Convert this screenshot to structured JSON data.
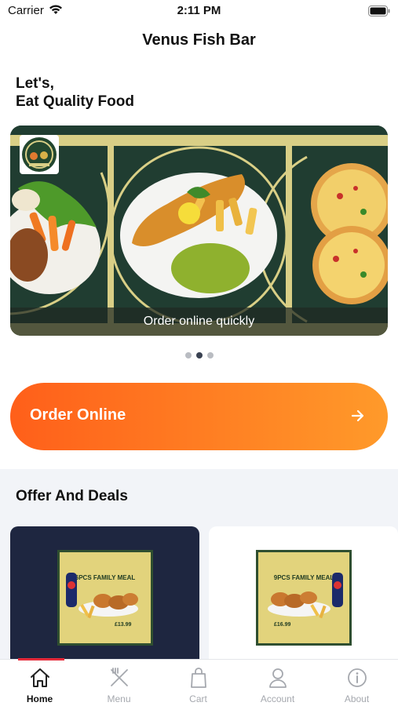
{
  "status_bar": {
    "carrier": "Carrier",
    "time": "2:11 PM"
  },
  "header": {
    "title": "Venus Fish Bar"
  },
  "greeting": {
    "line1": "Let's,",
    "line2": "Eat Quality Food"
  },
  "banner": {
    "caption": "Order online quickly",
    "active_slide": 2,
    "slide_count": 3
  },
  "order_button": {
    "label": "Order Online"
  },
  "offers": {
    "title": "Offer And Deals",
    "deals": [
      {
        "poster_title": "6PCS FAMILY MEAL",
        "price": "£13.99"
      },
      {
        "poster_title": "9PCS FAMILY MEAL",
        "price": "£16.99"
      }
    ]
  },
  "tabs": [
    {
      "label": "Home",
      "icon": "home-icon",
      "active": true
    },
    {
      "label": "Menu",
      "icon": "fork-knife-icon",
      "active": false
    },
    {
      "label": "Cart",
      "icon": "shopping-bag-icon",
      "active": false
    },
    {
      "label": "Account",
      "icon": "person-icon",
      "active": false
    },
    {
      "label": "About",
      "icon": "info-icon",
      "active": false
    }
  ],
  "colors": {
    "accent": "#ff6a1f",
    "tab_active": "#111111",
    "tab_inactive": "#a5a8ae",
    "indicator": "#e52a3a"
  }
}
